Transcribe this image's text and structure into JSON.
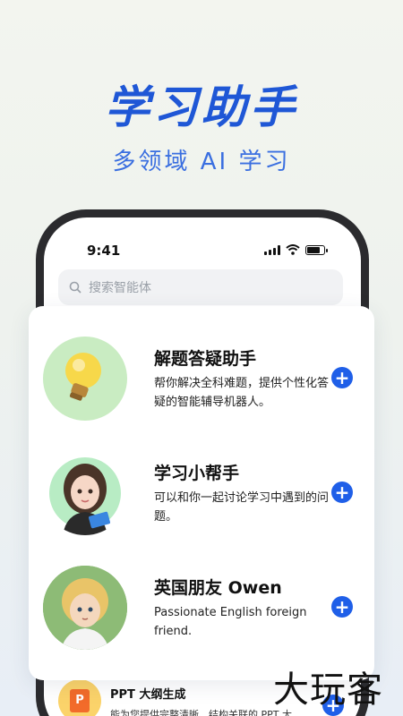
{
  "hero": {
    "title": "学习助手",
    "subtitle": "多领域 AI 学习"
  },
  "status_bar": {
    "time": "9:41"
  },
  "search": {
    "placeholder": "搜索智能体"
  },
  "agents": [
    {
      "name": "解题答疑助手",
      "description": "帮你解决全科难题，提供个性化答疑的智能辅导机器人。",
      "avatar": "lightbulb-icon",
      "add_label": "+"
    },
    {
      "name": "学习小帮手",
      "description": "可以和你一起讨论学习中遇到的问题。",
      "avatar": "girl-avatar",
      "add_label": "+"
    },
    {
      "name": "英国朋友 Owen",
      "description": "Passionate English foreign friend.",
      "avatar": "boy-avatar",
      "add_label": "+"
    }
  ],
  "peek_item": {
    "title": "PPT 大纲生成",
    "description": "能为您提供完整清晰、结构关联的 PPT 大",
    "icon_letter": "P"
  },
  "watermark": "大玩客",
  "colors": {
    "accent": "#1f5fe8",
    "title": "#1f57d6"
  }
}
